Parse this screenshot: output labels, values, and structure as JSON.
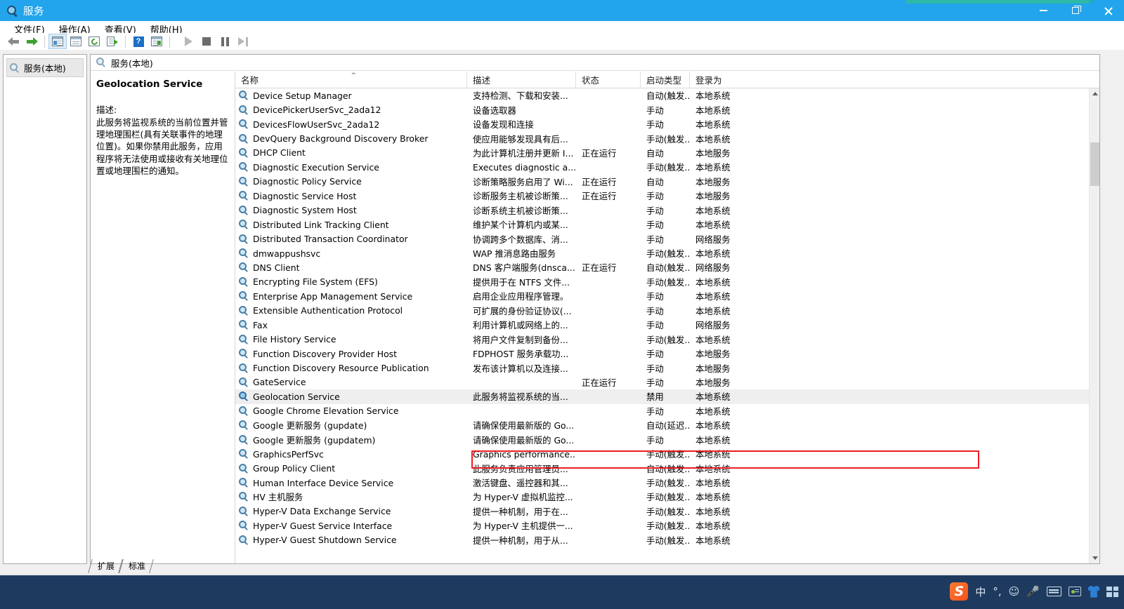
{
  "window": {
    "title": "服务",
    "icon": "services-gear-icon",
    "minimize_label": "最小化",
    "maximize_label": "最大化",
    "close_label": "关闭"
  },
  "menubar": {
    "items": [
      {
        "label": "文件(F)",
        "text": "文件(",
        "accel": "F",
        "tail": ")"
      },
      {
        "label": "操作(A)",
        "text": "操作(",
        "accel": "A",
        "tail": ")"
      },
      {
        "label": "查看(V)",
        "text": "查看(",
        "accel": "V",
        "tail": ")"
      },
      {
        "label": "帮助(H)",
        "text": "帮助(",
        "accel": "H",
        "tail": ")"
      }
    ]
  },
  "toolbar": {
    "buttons": [
      {
        "name": "back-icon",
        "tooltip": "后退"
      },
      {
        "name": "forward-icon",
        "tooltip": "前进"
      },
      {
        "name": "show-tree-icon",
        "tooltip": "显示/隐藏控制台树"
      },
      {
        "name": "properties-icon",
        "tooltip": "属性"
      },
      {
        "name": "refresh-icon",
        "tooltip": "刷新"
      },
      {
        "name": "export-list-icon",
        "tooltip": "导出列表"
      },
      {
        "name": "help-icon",
        "tooltip": "帮助"
      },
      {
        "name": "action-pane-icon",
        "tooltip": "显示/隐藏操作窗格"
      },
      {
        "name": "start-service-icon",
        "tooltip": "启动服务"
      },
      {
        "name": "stop-service-icon",
        "tooltip": "停止服务"
      },
      {
        "name": "pause-service-icon",
        "tooltip": "暂停服务"
      },
      {
        "name": "restart-service-icon",
        "tooltip": "重启服务"
      }
    ]
  },
  "tree": {
    "root_label": "服务(本地)"
  },
  "content": {
    "header_label": "服务(本地)"
  },
  "details": {
    "service_title": "Geolocation Service",
    "description_label": "描述:",
    "description_text": "此服务将监视系统的当前位置并管理地理围栏(具有关联事件的地理位置)。如果你禁用此服务，应用程序将无法使用或接收有关地理位置或地理围栏的通知。"
  },
  "list": {
    "columns": [
      {
        "key": "name",
        "label": "名称",
        "sorted": true,
        "sort_mark": "^"
      },
      {
        "key": "desc",
        "label": "描述",
        "sorted": false,
        "sort_mark": ""
      },
      {
        "key": "status",
        "label": "状态",
        "sorted": false,
        "sort_mark": ""
      },
      {
        "key": "start",
        "label": "启动类型",
        "sorted": false,
        "sort_mark": ""
      },
      {
        "key": "logon",
        "label": "登录为",
        "sorted": false,
        "sort_mark": ""
      }
    ],
    "rows": [
      {
        "name": "Device Setup Manager",
        "desc": "支持检测、下载和安装...",
        "status": "",
        "start": "自动(触发...",
        "logon": "本地系统",
        "selected": false,
        "highlighted": false
      },
      {
        "name": "DevicePickerUserSvc_2ada12",
        "desc": "设备选取器",
        "status": "",
        "start": "手动",
        "logon": "本地系统",
        "selected": false,
        "highlighted": false
      },
      {
        "name": "DevicesFlowUserSvc_2ada12",
        "desc": "设备发现和连接",
        "status": "",
        "start": "手动",
        "logon": "本地系统",
        "selected": false,
        "highlighted": false
      },
      {
        "name": "DevQuery Background Discovery Broker",
        "desc": "使应用能够发现具有后...",
        "status": "",
        "start": "手动(触发...",
        "logon": "本地系统",
        "selected": false,
        "highlighted": false
      },
      {
        "name": "DHCP Client",
        "desc": "为此计算机注册并更新 I...",
        "status": "正在运行",
        "start": "自动",
        "logon": "本地服务",
        "selected": false,
        "highlighted": false
      },
      {
        "name": "Diagnostic Execution Service",
        "desc": "Executes diagnostic a...",
        "status": "",
        "start": "手动(触发...",
        "logon": "本地系统",
        "selected": false,
        "highlighted": false
      },
      {
        "name": "Diagnostic Policy Service",
        "desc": "诊断策略服务启用了 Wi...",
        "status": "正在运行",
        "start": "自动",
        "logon": "本地服务",
        "selected": false,
        "highlighted": false
      },
      {
        "name": "Diagnostic Service Host",
        "desc": "诊断服务主机被诊断策...",
        "status": "正在运行",
        "start": "手动",
        "logon": "本地服务",
        "selected": false,
        "highlighted": false
      },
      {
        "name": "Diagnostic System Host",
        "desc": "诊断系统主机被诊断策...",
        "status": "",
        "start": "手动",
        "logon": "本地系统",
        "selected": false,
        "highlighted": false
      },
      {
        "name": "Distributed Link Tracking Client",
        "desc": "维护某个计算机内或某...",
        "status": "",
        "start": "手动",
        "logon": "本地系统",
        "selected": false,
        "highlighted": false
      },
      {
        "name": "Distributed Transaction Coordinator",
        "desc": "协调跨多个数据库、消...",
        "status": "",
        "start": "手动",
        "logon": "网络服务",
        "selected": false,
        "highlighted": false
      },
      {
        "name": "dmwappushsvc",
        "desc": "WAP 推消息路由服务",
        "status": "",
        "start": "手动(触发...",
        "logon": "本地系统",
        "selected": false,
        "highlighted": false
      },
      {
        "name": "DNS Client",
        "desc": "DNS 客户端服务(dnsca...",
        "status": "正在运行",
        "start": "自动(触发...",
        "logon": "网络服务",
        "selected": false,
        "highlighted": false
      },
      {
        "name": "Encrypting File System (EFS)",
        "desc": "提供用于在 NTFS 文件...",
        "status": "",
        "start": "手动(触发...",
        "logon": "本地系统",
        "selected": false,
        "highlighted": false
      },
      {
        "name": "Enterprise App Management Service",
        "desc": "启用企业应用程序管理。",
        "status": "",
        "start": "手动",
        "logon": "本地系统",
        "selected": false,
        "highlighted": false
      },
      {
        "name": "Extensible Authentication Protocol",
        "desc": "可扩展的身份验证协议(...",
        "status": "",
        "start": "手动",
        "logon": "本地系统",
        "selected": false,
        "highlighted": false
      },
      {
        "name": "Fax",
        "desc": "利用计算机或网络上的...",
        "status": "",
        "start": "手动",
        "logon": "网络服务",
        "selected": false,
        "highlighted": false
      },
      {
        "name": "File History Service",
        "desc": "将用户文件复制到备份...",
        "status": "",
        "start": "手动(触发...",
        "logon": "本地系统",
        "selected": false,
        "highlighted": false
      },
      {
        "name": "Function Discovery Provider Host",
        "desc": "FDPHOST 服务承载功...",
        "status": "",
        "start": "手动",
        "logon": "本地服务",
        "selected": false,
        "highlighted": false
      },
      {
        "name": "Function Discovery Resource Publication",
        "desc": "发布该计算机以及连接...",
        "status": "",
        "start": "手动",
        "logon": "本地服务",
        "selected": false,
        "highlighted": false
      },
      {
        "name": "GateService",
        "desc": "",
        "status": "正在运行",
        "start": "手动",
        "logon": "本地服务",
        "selected": false,
        "highlighted": true
      },
      {
        "name": "Geolocation Service",
        "desc": "此服务将监视系统的当...",
        "status": "",
        "start": "禁用",
        "logon": "本地系统",
        "selected": true,
        "highlighted": false
      },
      {
        "name": "Google Chrome Elevation Service",
        "desc": "",
        "status": "",
        "start": "手动",
        "logon": "本地系统",
        "selected": false,
        "highlighted": false
      },
      {
        "name": "Google 更新服务 (gupdate)",
        "desc": "请确保使用最新版的 Go...",
        "status": "",
        "start": "自动(延迟...",
        "logon": "本地系统",
        "selected": false,
        "highlighted": false
      },
      {
        "name": "Google 更新服务 (gupdatem)",
        "desc": "请确保使用最新版的 Go...",
        "status": "",
        "start": "手动",
        "logon": "本地系统",
        "selected": false,
        "highlighted": false
      },
      {
        "name": "GraphicsPerfSvc",
        "desc": "Graphics performance...",
        "status": "",
        "start": "手动(触发...",
        "logon": "本地系统",
        "selected": false,
        "highlighted": false
      },
      {
        "name": "Group Policy Client",
        "desc": "此服务负责应用管理员...",
        "status": "",
        "start": "自动(触发...",
        "logon": "本地系统",
        "selected": false,
        "highlighted": false
      },
      {
        "name": "Human Interface Device Service",
        "desc": "激活键盘、遥控器和其...",
        "status": "",
        "start": "手动(触发...",
        "logon": "本地系统",
        "selected": false,
        "highlighted": false
      },
      {
        "name": "HV 主机服务",
        "desc": "为 Hyper-V 虚拟机监控...",
        "status": "",
        "start": "手动(触发...",
        "logon": "本地系统",
        "selected": false,
        "highlighted": false
      },
      {
        "name": "Hyper-V Data Exchange Service",
        "desc": "提供一种机制，用于在...",
        "status": "",
        "start": "手动(触发...",
        "logon": "本地系统",
        "selected": false,
        "highlighted": false
      },
      {
        "name": "Hyper-V Guest Service Interface",
        "desc": "为 Hyper-V 主机提供一...",
        "status": "",
        "start": "手动(触发...",
        "logon": "本地系统",
        "selected": false,
        "highlighted": false
      },
      {
        "name": "Hyper-V Guest Shutdown Service",
        "desc": "提供一种机制，用于从...",
        "status": "",
        "start": "手动(触发...",
        "logon": "本地系统",
        "selected": false,
        "highlighted": false
      }
    ]
  },
  "tabs": [
    {
      "label": "扩展",
      "active": false
    },
    {
      "label": "标准",
      "active": true
    }
  ],
  "taskbar": {
    "ime": {
      "logo_text": "S",
      "mode_label": "中",
      "punctuation_label": "°,",
      "emoji_label": "☺",
      "mic_label": "mic-icon",
      "keyboard_label": "keyboard-icon",
      "card_label": "id-card-icon",
      "skin_label": "skin-icon",
      "apps_label": "apps-icon"
    }
  },
  "colors": {
    "titlebar": "#22a5ec",
    "accent_strip": "#2fb8a8",
    "highlight_box": "#ec1c24",
    "selected_row": "#efefef",
    "taskbar": "#1f3a5f"
  }
}
